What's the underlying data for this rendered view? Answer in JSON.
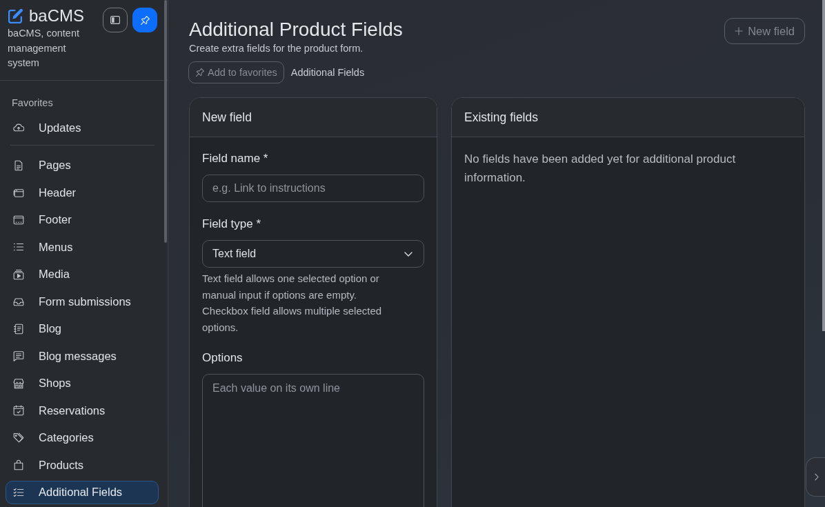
{
  "sidebar": {
    "brand": {
      "name": "baCMS",
      "tagline": "baCMS, content management system"
    },
    "pinned": true,
    "sections": [
      {
        "title": "Favorites",
        "items": [
          {
            "label": "Updates",
            "selected": false
          }
        ]
      },
      {
        "items": [
          {
            "label": "Pages",
            "selected": false
          },
          {
            "label": "Header",
            "selected": false
          },
          {
            "label": "Footer",
            "selected": false
          },
          {
            "label": "Menus",
            "selected": false
          },
          {
            "label": "Media",
            "selected": false
          },
          {
            "label": "Form submissions",
            "selected": false
          },
          {
            "label": "Blog",
            "selected": false
          },
          {
            "label": "Blog messages",
            "selected": false
          },
          {
            "label": "Shops",
            "selected": false
          },
          {
            "label": "Reservations",
            "selected": false
          },
          {
            "label": "Categories",
            "selected": false
          },
          {
            "label": "Products",
            "selected": false
          },
          {
            "label": "Additional Fields",
            "selected": true
          }
        ]
      }
    ]
  },
  "header": {
    "title": "Additional Product Fields",
    "subtitle": "Create extra fields for the product form.",
    "favorite_button": "Add to favorites",
    "breadcrumb": "Additional Fields",
    "new_field_button": "New field"
  },
  "new_field_panel": {
    "title": "New field",
    "fields": [
      {
        "kind": "text",
        "label": "Field name *",
        "placeholder": "e.g. Link to instructions"
      },
      {
        "kind": "select",
        "label": "Field type *",
        "value": "Text field",
        "help": "Text field allows one selected option or manual input if options are empty. Checkbox field allows multiple selected options."
      },
      {
        "kind": "textarea",
        "label": "Options",
        "placeholder": "Each value on its own line"
      }
    ]
  },
  "existing_fields_panel": {
    "title": "Existing fields",
    "empty_message": "No fields have been added yet for additional product information."
  }
}
